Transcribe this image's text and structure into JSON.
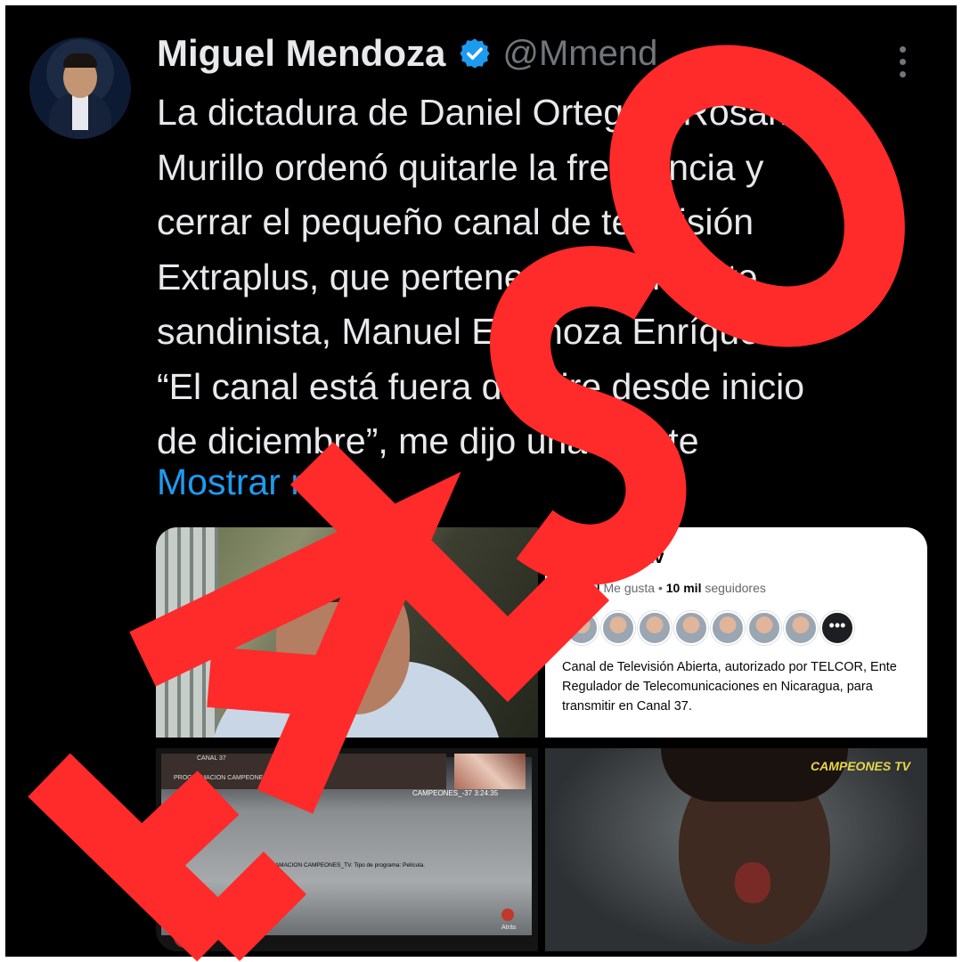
{
  "tweet": {
    "author_name": "Miguel Mendoza",
    "handle": "@Mmend",
    "verified_icon": "verified-badge-icon",
    "lines": [
      "La dictadura de Daniel Ortega y Rosario",
      "Murillo ordenó quitarle la frecuencia y",
      "cerrar el pequeño canal de televisión",
      "Extraplus, que pertenecía al militante",
      "sandinista, Manuel Espinoza Enríquez.",
      "“El canal está fuera del aire desde inicio",
      "de diciembre”, me dijo una fuente"
    ],
    "show_more": "Mostrar más"
  },
  "media": {
    "fb_card": {
      "page_name": "ExtraPlustv",
      "likes_count": "4,4 mil",
      "likes_label": "Me gusta",
      "separator": "•",
      "followers_count": "10 mil",
      "followers_label": "seguidores",
      "description": "Canal de Televisión Abierta, autorizado por TELCOR, Ente Regulador de Telecomunicaciones en Nicaragua, para transmitir en Canal 37."
    },
    "tv_screen": {
      "top_label": "CANAL 37",
      "program_label": "PROGRAMACION CAMPEONES_TV",
      "clock": "CAMPEONES_-37  3:24:35",
      "program_info": "PROGRAMACION CAMPEONES_TV.  Tipo de programa: Película.",
      "back_label": "Atrás"
    },
    "campeones_logo": "CAMPEONES TV"
  },
  "overlay": {
    "stamp_text": "FALSO",
    "stamp_color": "#ff2a2a"
  }
}
